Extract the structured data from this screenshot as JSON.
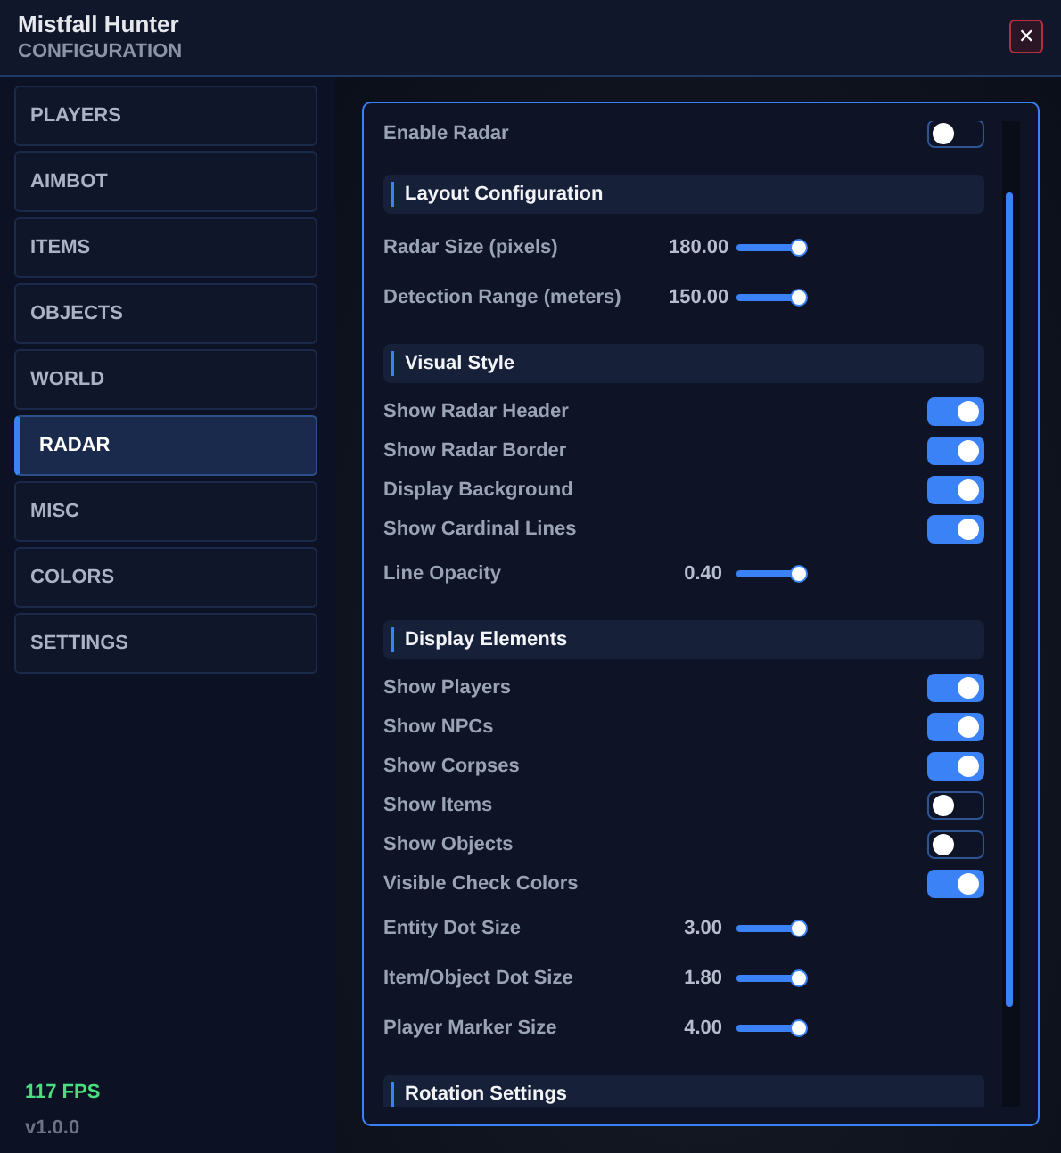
{
  "window": {
    "title": "Mistfall Hunter",
    "subtitle": "CONFIGURATION",
    "close_label": "✕"
  },
  "sidebar": {
    "items": [
      {
        "label": "PLAYERS",
        "selected": false
      },
      {
        "label": "AIMBOT",
        "selected": false
      },
      {
        "label": "ITEMS",
        "selected": false
      },
      {
        "label": "OBJECTS",
        "selected": false
      },
      {
        "label": "WORLD",
        "selected": false
      },
      {
        "label": "RADAR",
        "selected": true
      },
      {
        "label": "MISC",
        "selected": false
      },
      {
        "label": "COLORS",
        "selected": false
      },
      {
        "label": "SETTINGS",
        "selected": false
      }
    ],
    "fps": "117 FPS",
    "version": "v1.0.0"
  },
  "panel": {
    "rows": [
      {
        "kind": "edge"
      },
      {
        "kind": "toggle",
        "label": "Enable Radar",
        "on": false
      },
      {
        "kind": "section",
        "label": "Layout Configuration"
      },
      {
        "kind": "slider",
        "label": "Radar Size (pixels)",
        "reading": "180.00"
      },
      {
        "kind": "slider",
        "label": "Detection Range (meters)",
        "reading": "150.00"
      },
      {
        "kind": "section",
        "label": "Visual Style"
      },
      {
        "kind": "toggle",
        "label": "Show Radar Header",
        "on": true
      },
      {
        "kind": "toggle",
        "label": "Show Radar Border",
        "on": true
      },
      {
        "kind": "toggle",
        "label": "Display Background",
        "on": true
      },
      {
        "kind": "toggle",
        "label": "Show Cardinal Lines",
        "on": true
      },
      {
        "kind": "slider",
        "label": "Line Opacity",
        "reading": "0.40"
      },
      {
        "kind": "section",
        "label": "Display Elements"
      },
      {
        "kind": "toggle",
        "label": "Show Players",
        "on": true
      },
      {
        "kind": "toggle",
        "label": "Show NPCs",
        "on": true
      },
      {
        "kind": "toggle",
        "label": "Show Corpses",
        "on": true
      },
      {
        "kind": "toggle",
        "label": "Show Items",
        "on": false
      },
      {
        "kind": "toggle",
        "label": "Show Objects",
        "on": false
      },
      {
        "kind": "toggle",
        "label": "Visible Check Colors",
        "on": true
      },
      {
        "kind": "slider",
        "label": "Entity Dot Size",
        "reading": "3.00"
      },
      {
        "kind": "slider",
        "label": "Item/Object Dot Size",
        "reading": "1.80"
      },
      {
        "kind": "slider",
        "label": "Player Marker Size",
        "reading": "4.00"
      },
      {
        "kind": "section",
        "label": "Rotation Settings"
      }
    ]
  }
}
